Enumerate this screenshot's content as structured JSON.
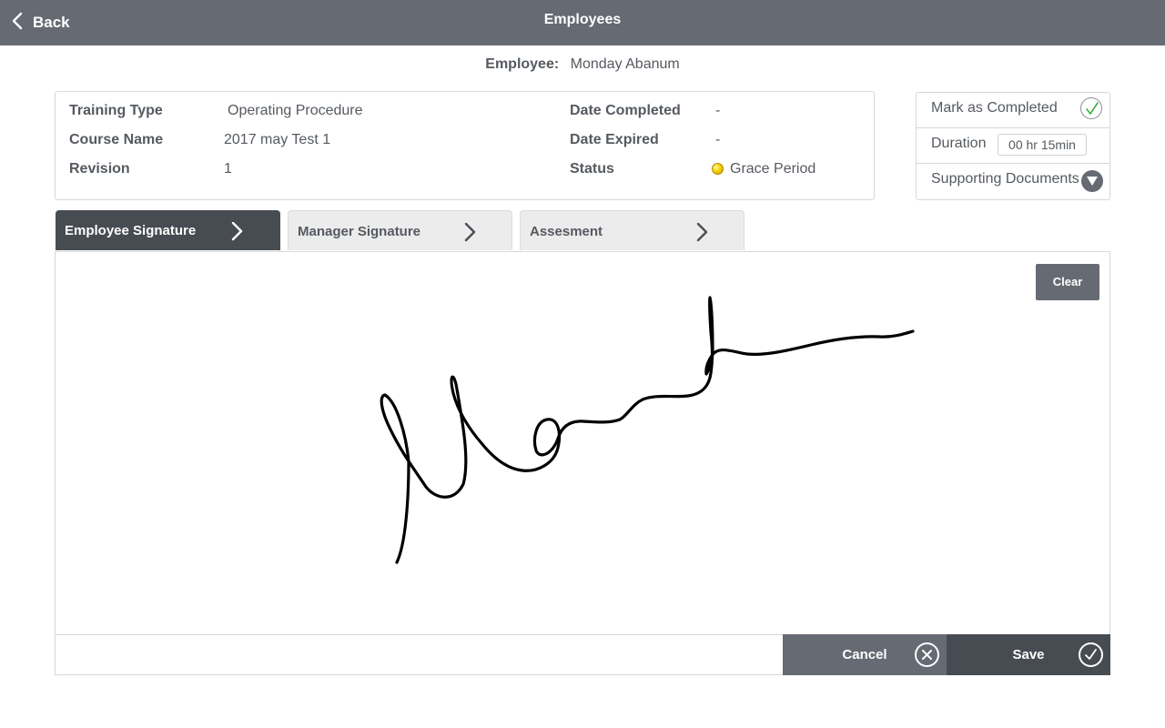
{
  "header": {
    "back_label": "Back",
    "title": "Employees"
  },
  "employee": {
    "label": "Employee:",
    "name": "Monday Abanum"
  },
  "details": {
    "training_type_label": "Training Type",
    "training_type_value": "Operating Procedure",
    "course_name_label": "Course Name",
    "course_name_value": "2017 may Test 1",
    "revision_label": "Revision",
    "revision_value": "1",
    "date_completed_label": "Date Completed",
    "date_completed_value": "-",
    "date_expired_label": "Date Expired",
    "date_expired_value": "-",
    "status_label": "Status",
    "status_value": "Grace Period",
    "status_color": "#f6d000"
  },
  "side_panel": {
    "mark_completed_label": "Mark as Completed",
    "mark_completed_icon": "check-icon",
    "duration_label": "Duration",
    "duration_value": "00 hr 15min",
    "supporting_docs_label": "Supporting Documents",
    "supporting_docs_icon": "chevron-down-icon"
  },
  "tabs": [
    {
      "label": "Employee Signature",
      "active": true
    },
    {
      "label": "Manager Signature",
      "active": false
    },
    {
      "label": "Assesment",
      "active": false
    }
  ],
  "signature": {
    "clear_label": "Clear"
  },
  "actions": {
    "cancel_label": "Cancel",
    "save_label": "Save"
  },
  "colors": {
    "header_bg": "#656a73",
    "active_tab_bg": "#474b52",
    "accent_check": "#3cb043"
  }
}
